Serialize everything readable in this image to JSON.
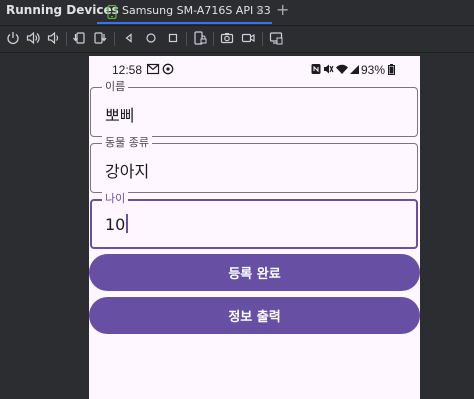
{
  "tool_window": {
    "title": "Running Devices",
    "tab_label": "Samsung SM-A716S API 33",
    "tab_close": "×",
    "add_tab": "+"
  },
  "toolbar": {
    "icons": [
      "power-icon",
      "volume-up-icon",
      "volume-down-icon",
      "rotate-left-icon",
      "rotate-right-icon",
      "back-icon",
      "home-icon",
      "overview-icon",
      "device-lock-icon",
      "screenshot-icon",
      "screen-record-icon",
      "device-frame-icon"
    ]
  },
  "phone": {
    "status_bar": {
      "time": "12:58",
      "left_icons": [
        "gmail-icon",
        "sync-icon"
      ],
      "right_icons": [
        "nfc-icon",
        "mute-icon",
        "wifi-icon",
        "signal-icon"
      ],
      "battery": "93%"
    },
    "fields": [
      {
        "label": "이름",
        "value": "뽀삐"
      },
      {
        "label": "동물 종류",
        "value": "강아지"
      },
      {
        "label": "나이",
        "value": "10"
      }
    ],
    "buttons": {
      "register": "등록 완료",
      "print_info": "정보 출력"
    },
    "colors": {
      "primary": "#6750a4",
      "surface": "#fef7ff",
      "outline": "#79747e"
    }
  }
}
